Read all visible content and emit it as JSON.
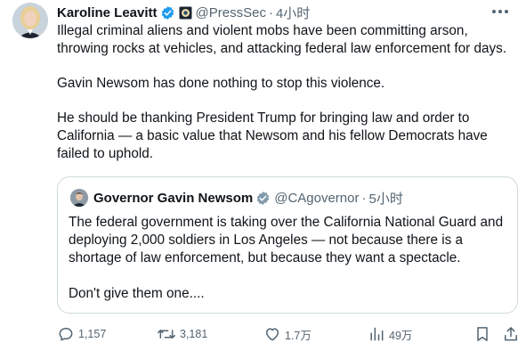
{
  "tweet": {
    "author_name": "Karoline Leavitt",
    "author_handle": "@PressSec",
    "separator": "·",
    "time": "4小时",
    "paragraphs": [
      "Illegal criminal aliens and violent mobs have been committing arson, throwing rocks at vehicles, and attacking federal law enforcement for days.",
      "Gavin Newsom has done nothing to stop this violence.",
      "He should be thanking President Trump for bringing law and order to California — a basic value that Newsom and his fellow Democrats have failed to uphold."
    ]
  },
  "quoted_tweet": {
    "author_name": "Governor Gavin Newsom",
    "author_handle": "@CAgovernor",
    "separator": "·",
    "time": "5小时",
    "paragraphs": [
      "The federal government is taking over the California National Guard and deploying 2,000 soldiers in Los Angeles — not because there is a shortage of law enforcement, but because they want a spectacle.",
      "Don't give them one...."
    ]
  },
  "actions": {
    "replies": "1,157",
    "reposts": "3,181",
    "likes": "1.7万",
    "views": "49万"
  },
  "colors": {
    "text": "#0f1419",
    "secondary": "#536471",
    "verified_blue": "#1d9bf0",
    "quote_border": "#cfd9de"
  },
  "icons": [
    "verified-badge-icon",
    "government-badge-icon",
    "more-icon",
    "reply-icon",
    "repost-icon",
    "like-icon",
    "views-icon",
    "bookmark-icon",
    "share-icon"
  ]
}
